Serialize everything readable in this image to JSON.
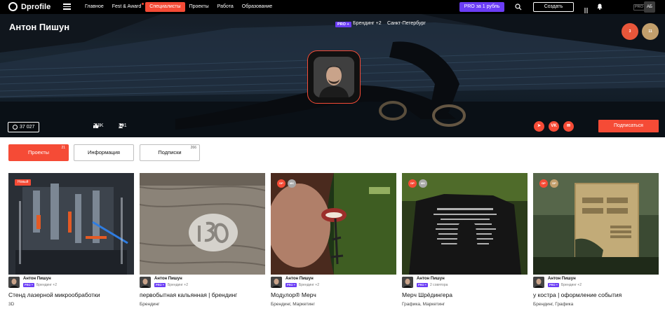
{
  "nav": {
    "logo": "Dprofile",
    "menu": [
      {
        "label": "Главное",
        "active": false,
        "dot": false
      },
      {
        "label": "Fest & Award",
        "active": false,
        "dot": true
      },
      {
        "label": "Специалисты",
        "active": true,
        "dot": false
      },
      {
        "label": "Проекты",
        "active": false,
        "dot": false
      },
      {
        "label": "Работа",
        "active": false,
        "dot": false
      },
      {
        "label": "Образование",
        "active": false,
        "dot": false
      }
    ],
    "pro_button": "PRO за 1 рубль",
    "create_button": "Создать",
    "pro_tag": "PRO",
    "avatar_initials": "АБ"
  },
  "profile": {
    "name": "Антон Пишун",
    "pro_badge": "PRO +",
    "specialization": "Брендинг +2",
    "city": "Санкт-Петербург",
    "views": "37 027",
    "likes": "2,8K",
    "followers": "391",
    "subscribe_button": "Подписаться",
    "award_badges": [
      {
        "label": "3",
        "color": "#e8563a"
      },
      {
        "label": "11",
        "color": "#c29f6c"
      }
    ],
    "socials": [
      {
        "name": "telegram-icon",
        "glyph": "➤"
      },
      {
        "name": "vk-icon",
        "glyph": "VK"
      },
      {
        "name": "email-icon",
        "glyph": "✉"
      }
    ]
  },
  "tabs": [
    {
      "label": "Проекты",
      "count": "21",
      "active": true
    },
    {
      "label": "Информация",
      "count": "",
      "active": false
    },
    {
      "label": "Подписки",
      "count": "266",
      "active": false
    }
  ],
  "cards": [
    {
      "title": "Стенд лазерной микрообработки",
      "category": "3D",
      "author": "Антон Пишун",
      "pro": "PRO +",
      "spec": "Брендинг +2",
      "new": "Новый",
      "badges": []
    },
    {
      "title": "первобытная кальянная | брендинг",
      "category": "Брендинг",
      "author": "Антон Пишун",
      "pro": "PRO +",
      "spec": "Брендинг +2",
      "new": "",
      "badges": []
    },
    {
      "title": "Модулор® Мерч",
      "category": "Брендинг, Маркетинг",
      "author": "Антон Пишун",
      "pro": "PRO +",
      "spec": "Брендинг +2",
      "new": "",
      "badges": [
        {
          "label": "DP",
          "color": "#f54b36"
        },
        {
          "label": "MK",
          "color": "#a9a9a9"
        }
      ]
    },
    {
      "title": "Мерч Шрёдингера",
      "category": "Графика, Маркетинг",
      "author": "Антон Пишун",
      "pro": "PRO +",
      "spec": "2 совятора",
      "new": "",
      "badges": [
        {
          "label": "DP",
          "color": "#f54b36"
        },
        {
          "label": "MK",
          "color": "#a9a9a9"
        }
      ]
    },
    {
      "title": "у костра | оформление события",
      "category": "Брендинг, Графика",
      "author": "Антон Пишун",
      "pro": "PRO +",
      "spec": "Брендинг +2",
      "new": "",
      "badges": [
        {
          "label": "DP",
          "color": "#f54b36"
        },
        {
          "label": "DP",
          "color": "#c29f6c"
        }
      ]
    }
  ]
}
